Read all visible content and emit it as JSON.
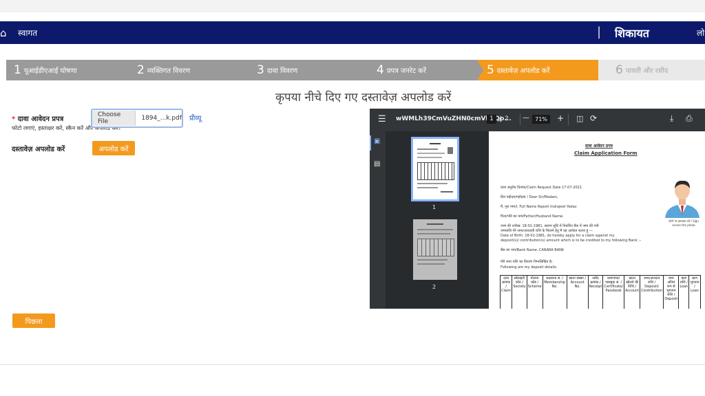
{
  "nav": {
    "home_icon": "home-icon",
    "welcome": "स्वागत",
    "title": "शिकायत",
    "right_cut": "लो"
  },
  "steps": [
    {
      "num": "1",
      "label": "यूआईडीएआई घोषणा"
    },
    {
      "num": "2",
      "label": "व्यक्तिगत विवरण"
    },
    {
      "num": "3",
      "label": "दावा विवरण"
    },
    {
      "num": "4",
      "label": "प्रपत्र जनरेट करें"
    },
    {
      "num": "5",
      "label": "दस्तावेज़ अपलोड करें"
    },
    {
      "num": "6",
      "label": "पावती और रसीद"
    }
  ],
  "colors": {
    "nav": "#0d1a6b",
    "active": "#f39a1e",
    "stepbar": "#9a9a9a",
    "link": "#1f57c7"
  },
  "form": {
    "heading": "कृपया नीचे दिए गए दस्तावेज़ अपलोड करें",
    "required_mark": "*",
    "claim_label": "दावा आवेदन प्रपत्र",
    "claim_hint": "फोटो लगाएं, हस्ताक्षर करें, स्कैन करें और अपलोड करें।",
    "file_button": "Choose File",
    "file_name": "1894_...k.pdf",
    "preview_link": "प्रीव्यू",
    "doc_upload_label": "दस्तावेज़ अपलोड करें",
    "upload_button": "अपलोड करें",
    "back_button": "पिछला"
  },
  "viewer": {
    "filename": "wWMLh39CmVuZHN0cmVhbQp...",
    "page_current": "1",
    "page_sep": "/",
    "page_total": "2",
    "zoom": "71%",
    "minus": "—",
    "plus": "+",
    "thumb1_num": "1",
    "thumb2_num": "2",
    "doc": {
      "title_hi": "दावा आवेदन प्रपत्र",
      "title_en": "Claim Application Form",
      "request_date": "दावा अनुरोध दिनांक/Claim Request Date 17-07-2021",
      "salutation": "प्रिय महोदय/महोदया / Dear Sir/Madam,",
      "full_name": "मैं, पूरा नाम/I, Full Name Rajesh Indrajeet Yadav",
      "father_name": "पिता/पति का नाम/Father/Husband Name:",
      "dob_hi": "जन्म की तारीख: 18-01-1981, सलग्न सूचि में निर्धारित बैंक में जमा की गयी",
      "dob_hi2": "जमाराशि मेरे जमा/अंशदायी राशि के मिलाने हेतु मैं यह आवेदन करता हूं —",
      "dob_en": "Date of Birth: 18-01-1981, do hereby apply for a claim against my",
      "dob_en2": "deposit(s)/ contribution(s) amount which is to be credited to my following Bank :–",
      "bank": "बैंक का नाम/Bank Name:   CANARA BANK",
      "deposit_hi": "मेरी जमा राशि का विवरण निम्नलिखित है।",
      "deposit_en": "Following are my deposit details:",
      "photo_caption": "फोटो पर हस्ताक्षर करें / Sign across the photo",
      "table_headers": [
        "दावा क्रमांक / Claim",
        "सोसाइटी कोड / Society",
        "योजना कोड / Scheme",
        "सदस्यता सं. / Membership No.",
        "खाता संख्या / Account No.",
        "रसीद क्रमांक / Receipt",
        "प्रमाणपत्र/पासबुक सं. / Certificate/ Passbook",
        "खाता खोलने की तिथि / Account",
        "जमा/अंशदान राशि / Deposit/ Contribution",
        "जमा अंतिम रूप से भुगतान राशि / Deposit",
        "ऋण राशि / Loan",
        "ऋण भुगतान / Loan"
      ]
    }
  }
}
